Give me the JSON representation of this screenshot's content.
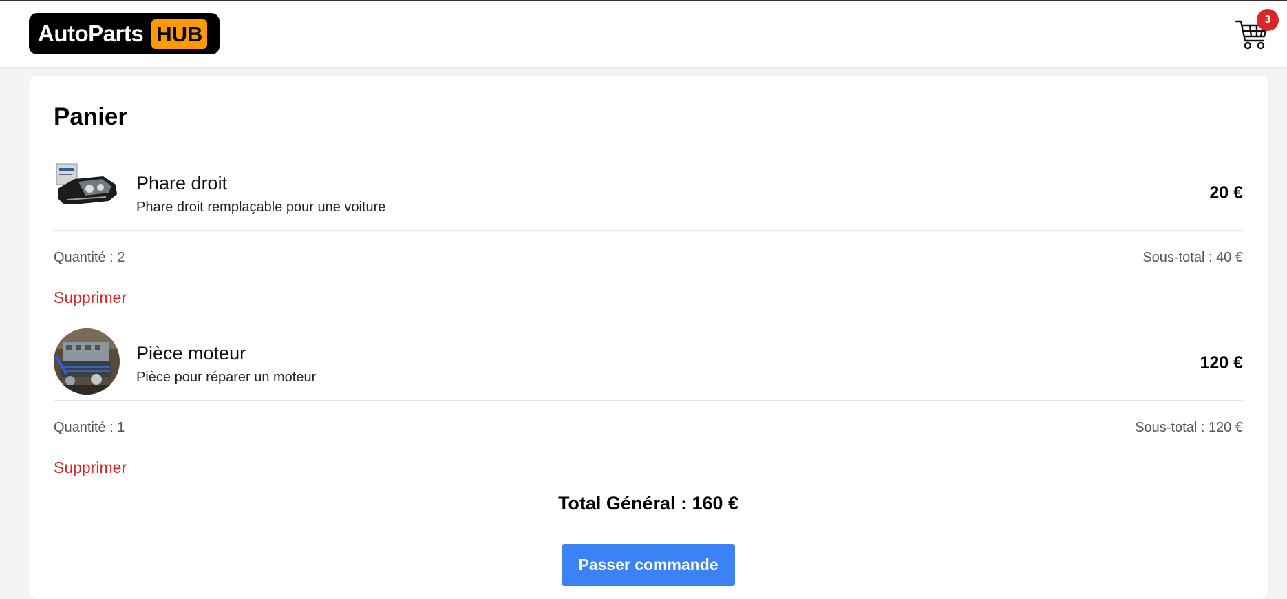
{
  "header": {
    "logo_main": "AutoParts",
    "logo_badge": "HUB",
    "cart_count": "3",
    "cart_icon": "shopping-cart-icon"
  },
  "cart": {
    "title": "Panier",
    "items": [
      {
        "name": "Phare droit",
        "description": "Phare droit remplaçable pour une voiture",
        "price": "20 €",
        "quantity_label": "Quantité : 2",
        "subtotal_label": "Sous-total : 40 €",
        "remove_label": "Supprimer"
      },
      {
        "name": "Pièce moteur",
        "description": "Pièce pour réparer un moteur",
        "price": "120 €",
        "quantity_label": "Quantité : 1",
        "subtotal_label": "Sous-total : 120 €",
        "remove_label": "Supprimer"
      }
    ],
    "grand_total": "Total Général : 160 €",
    "checkout_label": "Passer commande"
  },
  "colors": {
    "accent_orange": "#ff9900",
    "badge_red": "#dc2626",
    "remove_red": "#dc2626",
    "button_blue": "#3b82f6"
  }
}
